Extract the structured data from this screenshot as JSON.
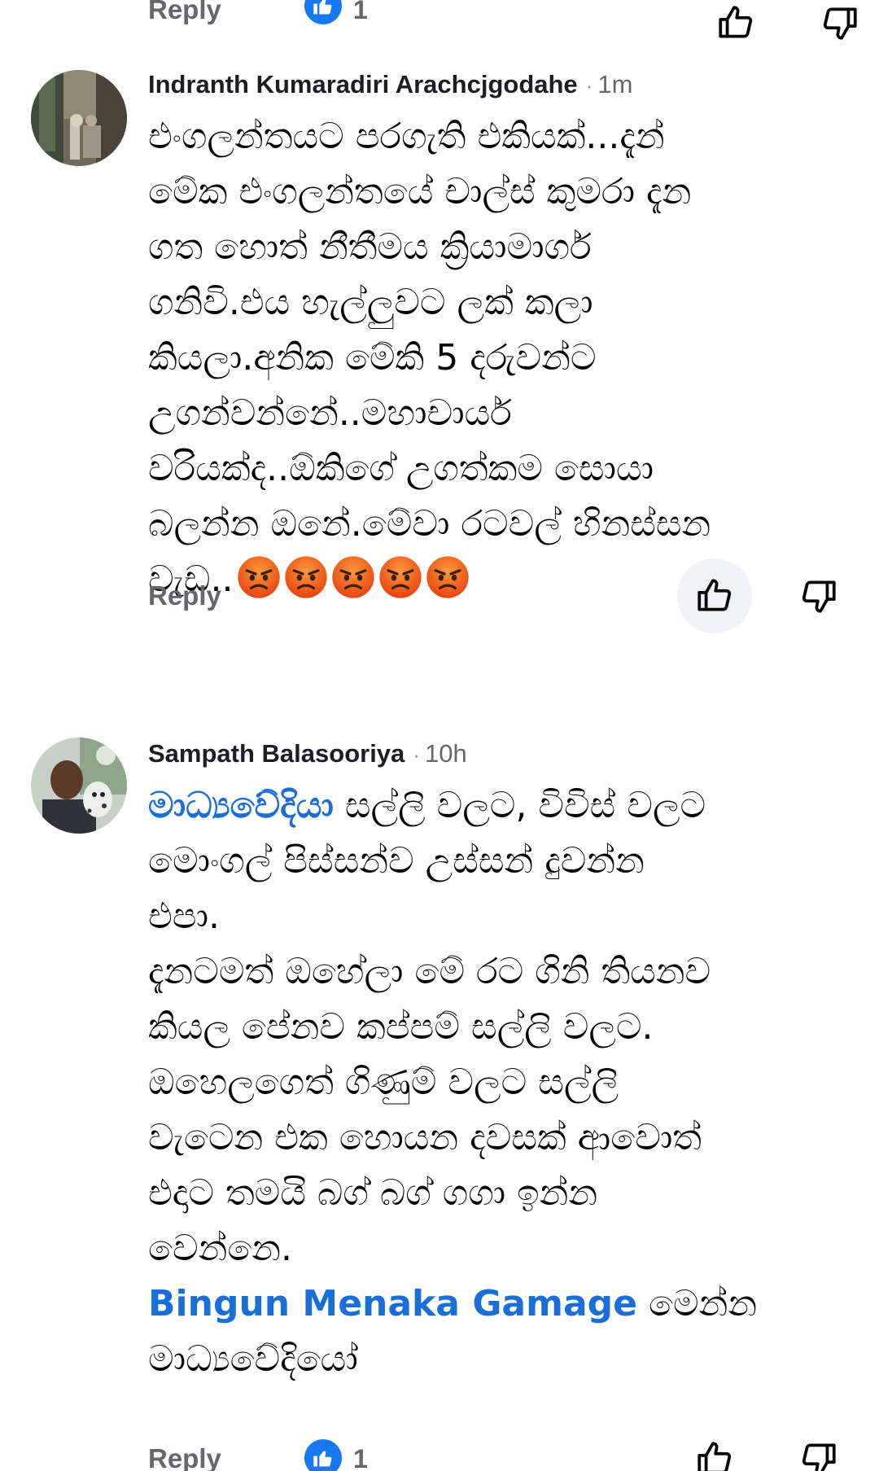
{
  "previous_comment_actions": {
    "reply_label": "Reply",
    "like_count": "1"
  },
  "comments": [
    {
      "author": "Indranth Kumaradiri Arachcjgodahe",
      "time": "1m",
      "body_lines": [
        "එංගලන්තයට පරගැති එකියක්...දැන්",
        "මේක එංගලන්තයේ චාල්ස් කුමරා දැන",
        "ගත හොත් නීතීමය ක්‍රියාමාර්ග",
        "ගනිවි.එය හැල්ලුවට ලක් කලා",
        "කියලා.අනික මේකි 5 දරුවන්ට",
        "උගන්වන්නේ..මහාචාර්ය",
        "වරියක්ද..ඕකිගේ උගත්කම සොයා",
        "බලන්න ඔනේ.මේවා රටවල් හිනස්සන"
      ],
      "last_line_text": "වැඩ..",
      "emoji_count": 5,
      "emoji_name": "angry-face-emoji",
      "reply_label": "Reply",
      "like_pressed": true
    },
    {
      "author": "Sampath Balasooriya",
      "time": "10h",
      "mention_1": "මාධ්‍යවේදියා",
      "first_line_rest": " සල්ලි වලට, විවිස් වලට",
      "body_lines": [
        "මොංගල් පිස්සන්ව උස්සන් දුවන්න",
        "එපා.",
        "දැනටමත් ඔහේලා මේ රට ගිනි තියනව",
        "කියල පේනව කප්පම් සල්ලි වලට.",
        "ඔහෙලගෙත් ගිණුම් වලට සල්ලි",
        "වැටෙන එක හොයන දවසක් ආවොත්",
        "එදාට තමයි බග් බග් ගගා ඉන්න",
        "වෙන්නෙ."
      ],
      "mention_2": "Bingun Menaka Gamage",
      "mention_2_rest": " මෙන්න",
      "last_line": "මාධ්‍යවේදියෝ",
      "reply_label": "Reply",
      "like_count": "1"
    }
  ],
  "colors": {
    "link_blue": "#1a6ed8",
    "like_blue": "#1877f2",
    "meta_gray": "#65676b",
    "pressed_bg": "#f0f2f5"
  },
  "icons": {
    "like": "thumbs-up-icon",
    "dislike": "thumbs-down-icon"
  }
}
